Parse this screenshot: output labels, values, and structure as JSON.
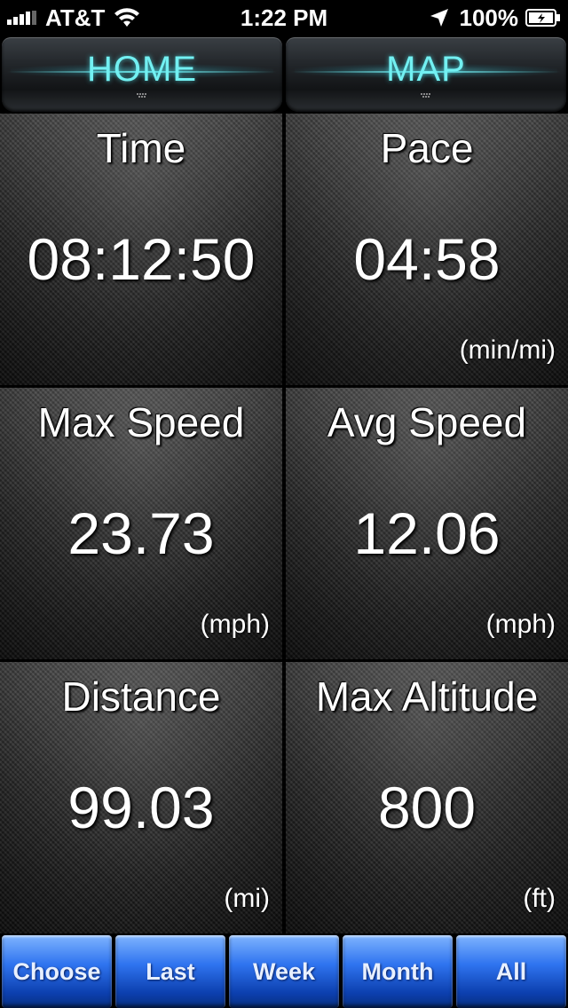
{
  "status_bar": {
    "carrier": "AT&T",
    "time": "1:22 PM",
    "battery": "100%",
    "icons": [
      "signal-icon",
      "wifi-icon",
      "location-arrow-icon",
      "battery-charging-icon"
    ]
  },
  "top_tabs": [
    {
      "label": "HOME"
    },
    {
      "label": "MAP"
    }
  ],
  "stats": [
    {
      "title": "Time",
      "value": "08:12:50",
      "unit": ""
    },
    {
      "title": "Pace",
      "value": "04:58",
      "unit": "(min/mi)"
    },
    {
      "title": "Max Speed",
      "value": "23.73",
      "unit": "(mph)"
    },
    {
      "title": "Avg Speed",
      "value": "12.06",
      "unit": "(mph)"
    },
    {
      "title": "Distance",
      "value": "99.03",
      "unit": "(mi)"
    },
    {
      "title": "Max Altitude",
      "value": "800",
      "unit": "(ft)"
    }
  ],
  "filters": [
    {
      "label": "Choose"
    },
    {
      "label": "Last"
    },
    {
      "label": "Week"
    },
    {
      "label": "Month"
    },
    {
      "label": "All"
    }
  ],
  "colors": {
    "tab_text": "#72f0f2",
    "filter_button": "#2f74ef",
    "background": "#000000"
  }
}
